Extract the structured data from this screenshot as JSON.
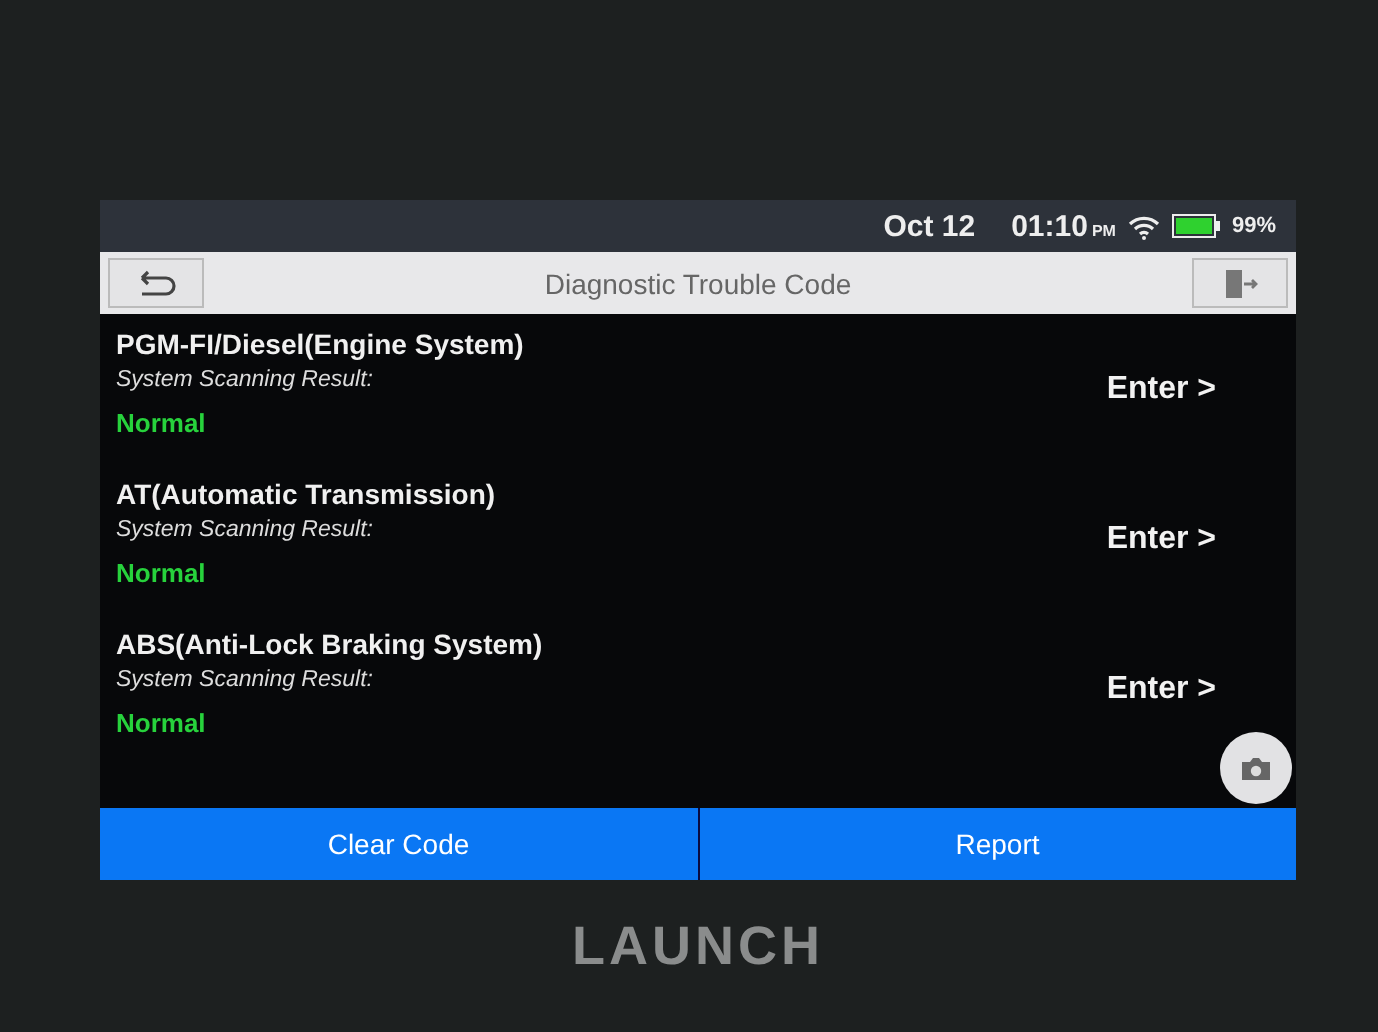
{
  "status_bar": {
    "date": "Oct 12",
    "time": "01:10",
    "ampm": "PM",
    "battery": "99%"
  },
  "title_bar": {
    "title": "Diagnostic Trouble Code"
  },
  "systems": [
    {
      "name": "PGM-FI/Diesel(Engine System)",
      "label": "System Scanning Result:",
      "result": "Normal",
      "action": "Enter >"
    },
    {
      "name": "AT(Automatic Transmission)",
      "label": "System Scanning Result:",
      "result": "Normal",
      "action": "Enter >"
    },
    {
      "name": "ABS(Anti-Lock Braking System)",
      "label": "System Scanning Result:",
      "result": "Normal",
      "action": "Enter >"
    }
  ],
  "buttons": [
    "Clear Code",
    "Report"
  ],
  "device": {
    "brand": "LAUNCH"
  }
}
